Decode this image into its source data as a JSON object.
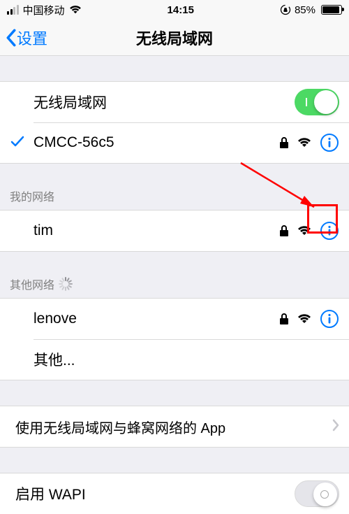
{
  "status": {
    "carrier": "中国移动",
    "time": "14:15",
    "battery_pct": "85%"
  },
  "nav": {
    "back_label": "设置",
    "title": "无线局域网"
  },
  "wlan": {
    "toggle_label": "无线局域网",
    "toggle_on": true,
    "connected": {
      "ssid": "CMCC-56c5",
      "locked": true
    }
  },
  "my_networks": {
    "header": "我的网络",
    "items": [
      {
        "ssid": "tim",
        "locked": true
      }
    ]
  },
  "other_networks": {
    "header": "其他网络",
    "items": [
      {
        "ssid": "lenove",
        "locked": true
      }
    ],
    "other_label": "其他..."
  },
  "app_row": {
    "label": "使用无线局域网与蜂窝网络的 App"
  },
  "wapi": {
    "label": "启用 WAPI",
    "on": false
  }
}
